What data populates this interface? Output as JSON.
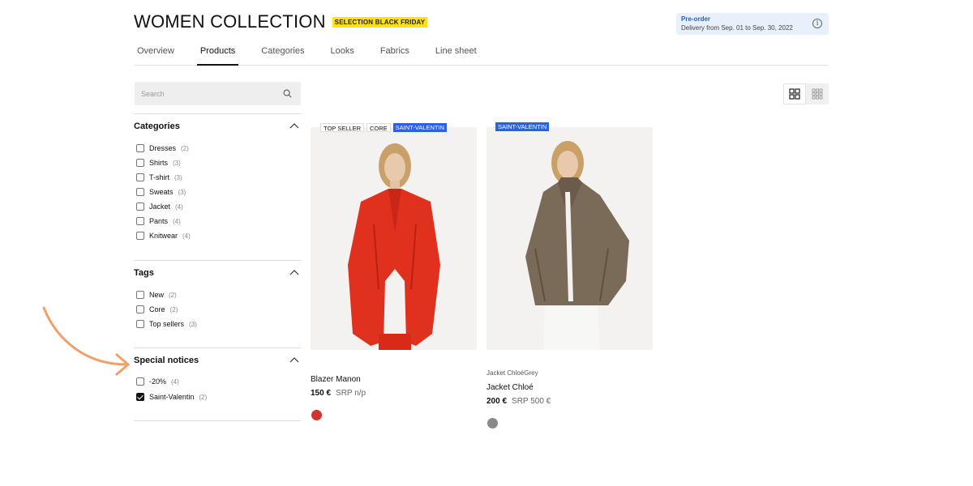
{
  "header": {
    "title": "WOMEN COLLECTION",
    "badge": "SELECTION BLACK FRIDAY"
  },
  "preorder": {
    "title": "Pre-order",
    "subtitle": "Delivery from Sep. 01 to Sep. 30, 2022",
    "icon": "info-icon"
  },
  "tabs": [
    {
      "label": "Overview"
    },
    {
      "label": "Products",
      "active": true
    },
    {
      "label": "Categories"
    },
    {
      "label": "Looks"
    },
    {
      "label": "Fabrics"
    },
    {
      "label": "Line sheet"
    }
  ],
  "search": {
    "placeholder": "Search",
    "icon": "search-icon"
  },
  "view_toggle": {
    "selected": "large-grid",
    "icons": [
      "large-grid-icon",
      "small-grid-icon"
    ]
  },
  "filters": {
    "categories": {
      "title": "Categories",
      "items": [
        {
          "label": "Dresses",
          "count": "(2)",
          "checked": false
        },
        {
          "label": "Shirts",
          "count": "(3)",
          "checked": false
        },
        {
          "label": "T-shirt",
          "count": "(3)",
          "checked": false
        },
        {
          "label": "Sweats",
          "count": "(3)",
          "checked": false
        },
        {
          "label": "Jacket",
          "count": "(4)",
          "checked": false
        },
        {
          "label": "Pants",
          "count": "(4)",
          "checked": false
        },
        {
          "label": "Knitwear",
          "count": "(4)",
          "checked": false
        }
      ]
    },
    "tags": {
      "title": "Tags",
      "items": [
        {
          "label": "New",
          "count": "(2)",
          "checked": false
        },
        {
          "label": "Core",
          "count": "(2)",
          "checked": false
        },
        {
          "label": "Top sellers",
          "count": "(3)",
          "checked": false
        }
      ]
    },
    "special": {
      "title": "Special notices",
      "items": [
        {
          "label": "-20%",
          "count": "(4)",
          "checked": false
        },
        {
          "label": "Saint-Valentin",
          "count": "(2)",
          "checked": true
        }
      ]
    }
  },
  "products": [
    {
      "tags": [
        "TOP SELLER",
        "CORE",
        "SAINT-VALENTIN"
      ],
      "brand_line": "",
      "name": "Blazer Manon",
      "price": "150 €",
      "srp": "SRP n/p",
      "swatch_color": "#d0342c"
    },
    {
      "tags": [
        "SAINT-VALENTIN"
      ],
      "brand_line": "Jacket ChloéGrey",
      "name": "Jacket Chloé",
      "price": "200 €",
      "srp": "SRP 500 €",
      "swatch_color": "#8a8a8a"
    }
  ],
  "colors": {
    "badge_yellow": "#ffe11a",
    "tag_blue": "#2b62e5",
    "preorder_bg": "#e8f0fb",
    "arrow_orange": "#f2a06a"
  }
}
